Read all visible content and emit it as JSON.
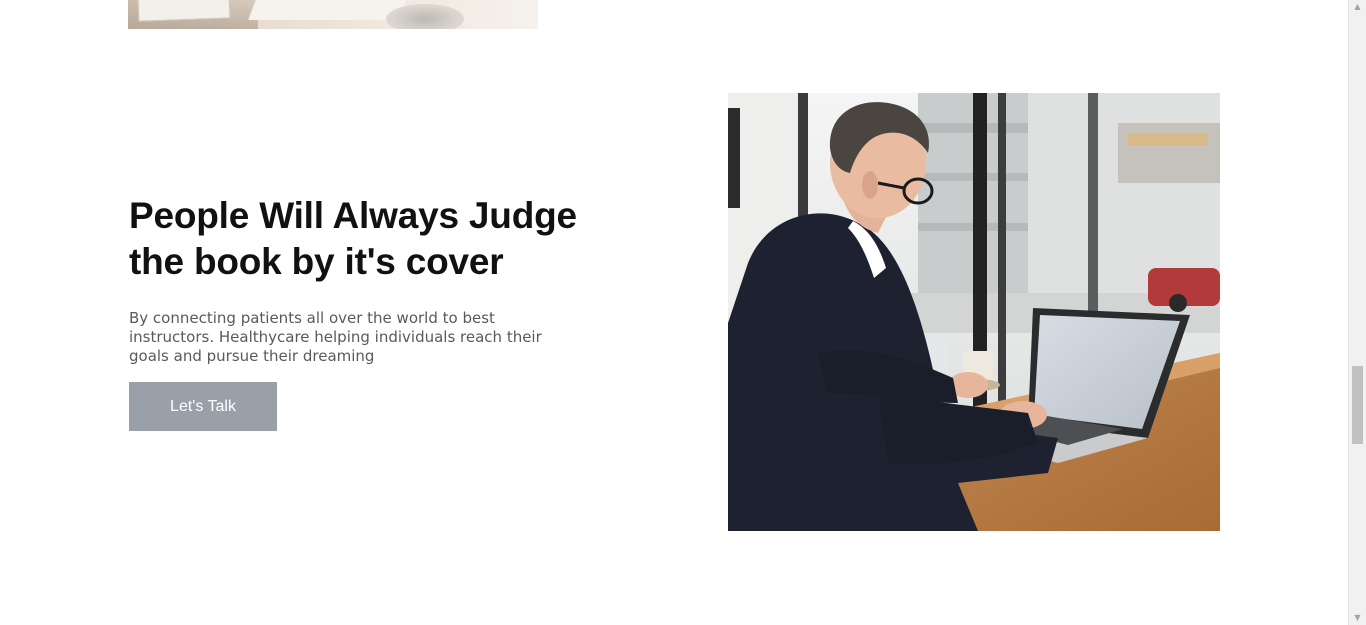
{
  "section": {
    "headline": "People Will Always Judge the book by it's cover",
    "description": "By connecting patients all over the world to best instructors. Healthycare helping individuals reach their goals and pursue their dreaming",
    "cta_label": "Let's Talk"
  },
  "colors": {
    "headline": "#111111",
    "body_text": "#5a5a5a",
    "button_bg": "#9aa0a9",
    "button_text": "#ffffff"
  },
  "images": {
    "top_image": "desk-workspace-photo",
    "feature_image": "man-working-on-laptop-photo"
  }
}
